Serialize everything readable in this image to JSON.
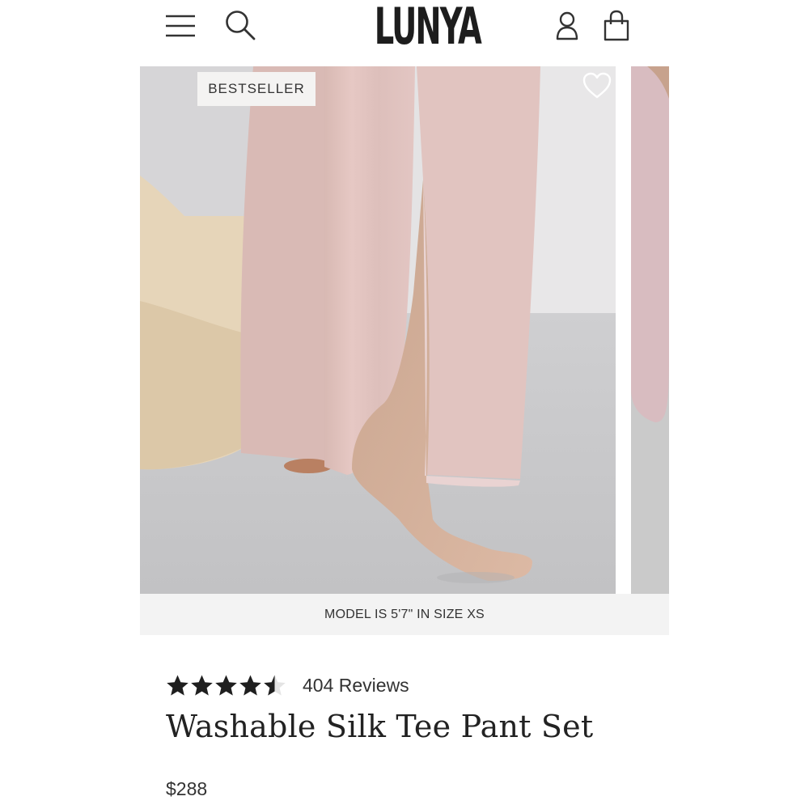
{
  "header": {
    "logo": "LUNYA",
    "icons": [
      "menu-icon",
      "search-icon",
      "account-icon",
      "shopping-bag-icon"
    ]
  },
  "product_gallery": {
    "badge": "BESTSELLER",
    "wishlist_icon": "heart-icon",
    "caption": "MODEL IS 5'7\" IN SIZE XS"
  },
  "product": {
    "rating": 4.5,
    "rating_max": 5,
    "reviews_label": "404 Reviews",
    "title": "Washable Silk Tee Pant Set",
    "price": "$288"
  },
  "colors": {
    "star_filled": "#1f1f1f",
    "star_empty": "#e4e4e4",
    "silk_pink": "#e6c8c5",
    "caption_bg": "#f3f3f3"
  }
}
